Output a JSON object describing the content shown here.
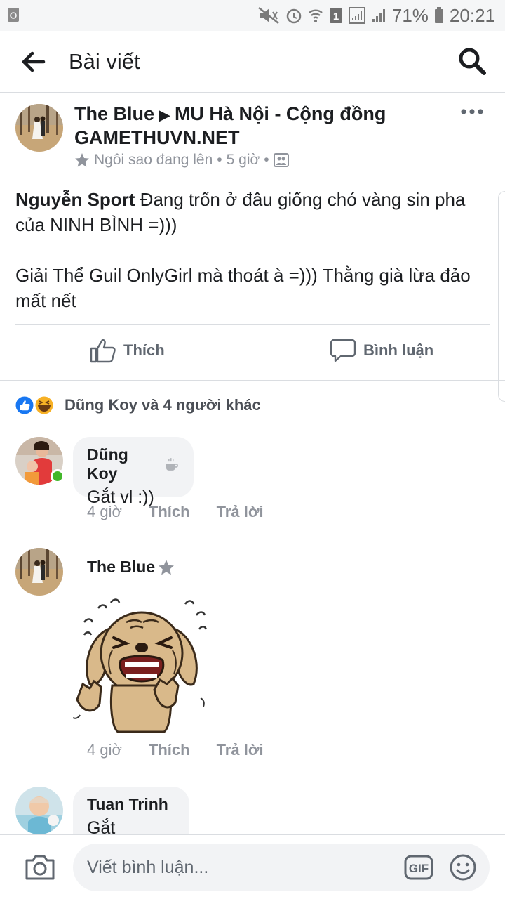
{
  "status_bar": {
    "battery": "71%",
    "time": "20:21",
    "icons": [
      "recycle-icon",
      "mute-icon",
      "alarm-icon",
      "wifi-icon",
      "sim1-icon",
      "signal-icon",
      "signal2-icon",
      "battery-icon"
    ]
  },
  "header": {
    "title": "Bài viết"
  },
  "post": {
    "author": "The Blue",
    "group": "MU Hà Nội - Cộng đồng GAMETHUVN.NET",
    "badge": "Ngôi sao đang lên",
    "time": "5 giờ",
    "mention": "Nguyễn Sport",
    "text1": " Đang trốn ở đâu giống chó vàng sin pha của NINH BÌNH =)))",
    "text2": "Giải Thể Guil OnlyGirl mà thoát à =))) Thằng già lừa đảo mất nết",
    "like_label": "Thích",
    "comment_label": "Bình luận"
  },
  "reactions": {
    "summary": "Dũng Koy và 4 người khác"
  },
  "comments": [
    {
      "name": "Dũng Koy",
      "text": "Gắt vl :))",
      "time": "4 giờ",
      "like": "Thích",
      "reply": "Trả lời"
    },
    {
      "name": "The Blue",
      "time": "4 giờ",
      "like": "Thích",
      "reply": "Trả lời"
    },
    {
      "name": "Tuan Trinh",
      "text": "Gắt"
    }
  ],
  "composer": {
    "placeholder": "Viết bình luận...",
    "gif_label": "GIF"
  },
  "colors": {
    "like_blue": "#1877f2",
    "text": "#1c1e21",
    "meta": "#90949c",
    "bubble": "#f2f3f5",
    "online": "#42b72a"
  }
}
